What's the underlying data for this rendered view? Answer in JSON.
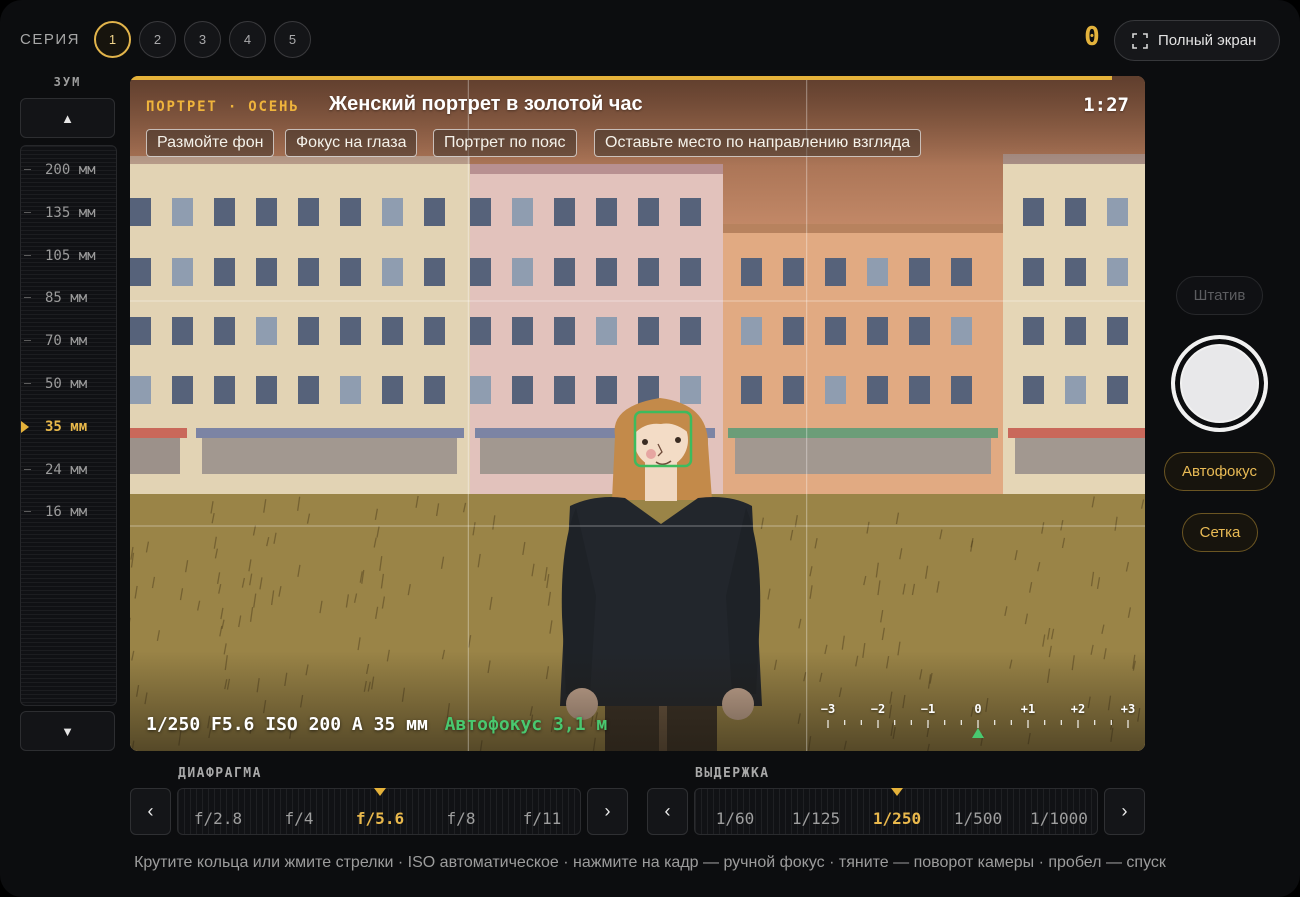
{
  "header": {
    "series_label": "СЕРИЯ",
    "series": [
      "1",
      "2",
      "3",
      "4",
      "5"
    ],
    "active_series": "1",
    "score": "0",
    "fullscreen_label": "Полный экран",
    "fullscreen_icon": "expand-corners-icon"
  },
  "zoom": {
    "label": "ЗУМ",
    "up_icon": "▲",
    "down_icon": "▼",
    "items": [
      "200 мм",
      "135 мм",
      "105 мм",
      "85 мм",
      "70 мм",
      "50 мм",
      "35 мм",
      "24 мм",
      "16 мм"
    ],
    "selected": "35 мм"
  },
  "viewfinder": {
    "genre": "ПОРТРЕТ · ОСЕНЬ",
    "title": "Женский портрет в золотой час",
    "timer": "1:27",
    "progress_fraction": 0.967,
    "tips": [
      "Размойте фон",
      "Фокус на глаза",
      "Портрет по пояс",
      "Оставьте место по направлению взгляда"
    ],
    "readout": {
      "shutter": "1/250",
      "aperture": "F5.6",
      "iso": "ISO 200 A",
      "focal": "35 мм",
      "autofocus": "Автофокус 3,1 м"
    },
    "exposure_scale": {
      "labels": [
        "−3",
        "−2",
        "−1",
        "0",
        "+1",
        "+2",
        "+3"
      ],
      "value": 0
    }
  },
  "right_controls": {
    "tripod_label": "Штатив",
    "autofocus_label": "Автофокус",
    "grid_label": "Сетка"
  },
  "aperture_dial": {
    "title": "ДИАФРАГМА",
    "items": [
      "f/2.8",
      "f/4",
      "f/5.6",
      "f/8",
      "f/11"
    ],
    "selected": "f/5.6",
    "prev_icon": "‹",
    "next_icon": "›"
  },
  "shutter_dial": {
    "title": "ВЫДЕРЖКА",
    "items": [
      "1/60",
      "1/125",
      "1/250",
      "1/500",
      "1/1000"
    ],
    "selected": "1/250",
    "prev_icon": "‹",
    "next_icon": "›"
  },
  "hint": "Крутите кольца или жмите стрелки · ISO автоматическое · нажмите на кадр — ручной фокус · тяните — поворот камеры · пробел — спуск",
  "colors": {
    "accent": "#e5b23a",
    "focus_green": "#49c86f",
    "background": "#0c0d0f"
  }
}
